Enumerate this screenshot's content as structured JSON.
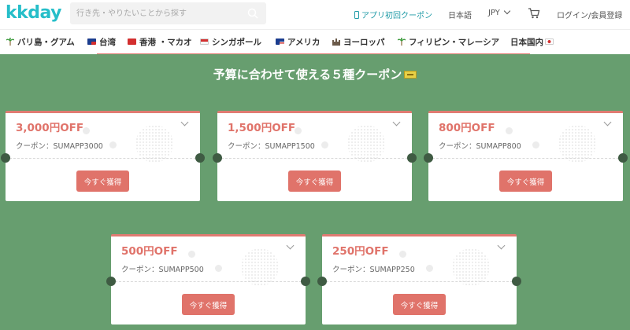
{
  "header": {
    "logo": "kkday",
    "search": {
      "placeholder": "行き先・やりたいことから探す"
    },
    "app_coupon": "アプリ初回クーポン",
    "language": "日本語",
    "currency": "JPY",
    "login": "ログイン/会員登録"
  },
  "nav": {
    "items": [
      {
        "label": "バリ島・グアム",
        "icon": "palm-tree-icon"
      },
      {
        "label": "台湾",
        "icon": "taiwan-flag-icon"
      },
      {
        "label": "香港 ・マカオ",
        "icon": "hong-kong-flag-icon"
      },
      {
        "label": "シンガポール",
        "icon": "singapore-flag-icon"
      },
      {
        "label": "アメリカ",
        "icon": "usa-flag-icon"
      },
      {
        "label": "ヨーロッパ",
        "icon": "castle-icon"
      },
      {
        "label": "フィリピン・マレーシア",
        "icon": "palm-tree-icon"
      },
      {
        "label": "日本国内",
        "icon": "japan-flag-icon"
      }
    ]
  },
  "main": {
    "title": "予算に合わせて使える５種クーポン",
    "coupons": [
      {
        "amount": "3,000円OFF",
        "code": "クーポン：SUMAPP3000",
        "button": "今すぐ獲得"
      },
      {
        "amount": "1,500円OFF",
        "code": "クーポン：SUMAPP1500",
        "button": "今すぐ獲得"
      },
      {
        "amount": "800円OFF",
        "code": "クーポン：SUMAPP800",
        "button": "今すぐ獲得"
      },
      {
        "amount": "500円OFF",
        "code": "クーポン：SUMAPP500",
        "button": "今すぐ獲得"
      },
      {
        "amount": "250円OFF",
        "code": "クーポン：SUMAPP250",
        "button": "今すぐ獲得"
      }
    ]
  },
  "colors": {
    "brand": "#26bec9",
    "accent": "#e0736a",
    "background": "#679e6f"
  }
}
